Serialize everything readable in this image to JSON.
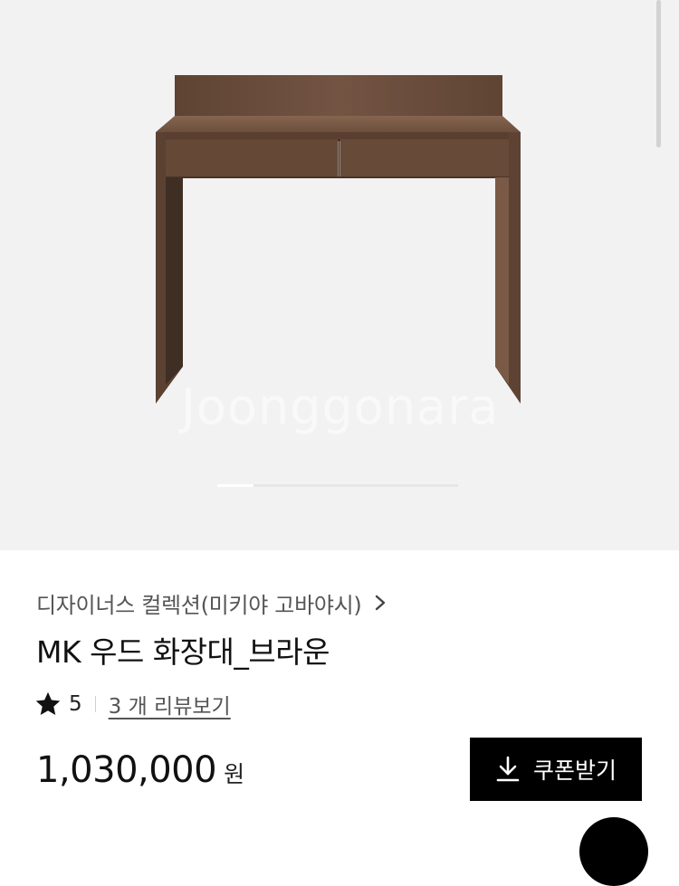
{
  "hero": {
    "watermark": "Joonggonara",
    "slide_progress": 0.15
  },
  "product": {
    "brand": "디자이너스 컬렉션(미키야 고바야시)",
    "title": "MK 우드 화장대_브라운",
    "rating": "5",
    "reviews_link": "3 개 리뷰보기",
    "price": "1,030,000",
    "currency": "원"
  },
  "actions": {
    "coupon_label": "쿠폰받기"
  },
  "icons": {
    "brand_arrow": "chevron-right-icon",
    "rating": "star-icon",
    "coupon": "download-icon",
    "floating": "floating-action-icon"
  },
  "colors": {
    "hero_bg": "#f2f2f2",
    "wood": "#6b4d3a",
    "button_bg": "#000000",
    "button_text": "#ffffff"
  }
}
